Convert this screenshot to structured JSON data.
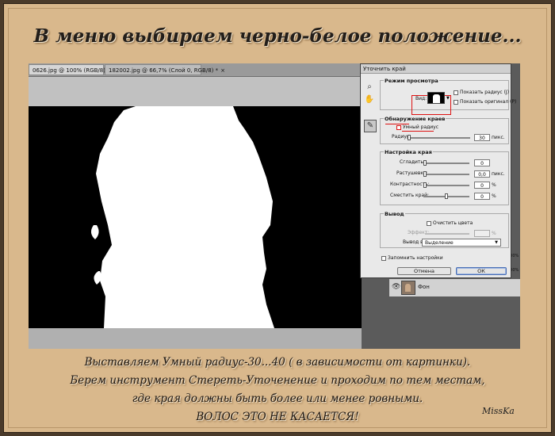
{
  "title": "В меню выбираем черно-белое положение...",
  "caption": {
    "lines": [
      "Выставляем Умный радиус-30...40 ( в зависимости от картинки).",
      "Берем инструмент Стереть-Уточенение и проходим по тем местам,",
      "где края должны быть более или менее ровными.",
      "ВОЛОС ЭТО НЕ КАСАЕТСЯ!"
    ]
  },
  "signature": "MissKa",
  "tabs": [
    {
      "label": "0626.jpg @ 100% (RGB/8) *",
      "close": "×"
    },
    {
      "label": "182002.jpg @ 66,7% (Слой 0, RGB/8) *",
      "close": "×"
    }
  ],
  "dialog": {
    "title": "Уточнить край",
    "view_mode": {
      "title": "Режим просмотра",
      "view_label": "Вид:",
      "show_radius": "Показать радиус (J)",
      "show_original": "Показать оригинал (P)"
    },
    "edge_detection": {
      "title": "Обнаружение краев",
      "smart_radius": "Умный радиус",
      "radius_label": "Радиус:",
      "radius_value": "30",
      "radius_unit": "пикс."
    },
    "adjust_edge": {
      "title": "Настройка края",
      "rows": [
        {
          "label": "Сгладить:",
          "value": "0",
          "unit": ""
        },
        {
          "label": "Растушевка:",
          "value": "0,0",
          "unit": "пикс."
        },
        {
          "label": "Контрастность:",
          "value": "0",
          "unit": "%"
        },
        {
          "label": "Сместить край:",
          "value": "0",
          "unit": "%"
        }
      ]
    },
    "output": {
      "title": "Вывод",
      "decontaminate": "Очистить цвета",
      "amount_label": "Эффект:",
      "amount_unit": "%",
      "output_to_label": "Вывод в:",
      "output_to_value": "Выделение"
    },
    "remember": "Запомнить настройки",
    "cancel": "Отмена",
    "ok": "ОК"
  },
  "layers": {
    "layer_name": "Фон"
  },
  "side_labels": [
    "100%",
    "100%"
  ],
  "icons": {
    "zoom": "zoom-icon",
    "hand": "hand-icon",
    "brush": "refine-brush-icon",
    "eye": "eye-icon"
  }
}
